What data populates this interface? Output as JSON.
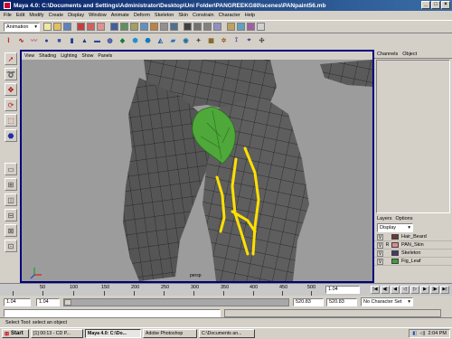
{
  "window": {
    "title": "Maya 4.0: C:\\Documents and Settings\\Administrator\\Desktop\\Uni Folder\\PANGREEKG80\\scenes\\PANpaint56.mb"
  },
  "menu": [
    "File",
    "Edit",
    "Modify",
    "Create",
    "Display",
    "Window",
    "Animate",
    "Deform",
    "Skeleton",
    "Skin",
    "Constrain",
    "Character",
    "Help"
  ],
  "statusline": {
    "mode": "Animation"
  },
  "panel_menu": [
    "View",
    "Shading",
    "Lighting",
    "Show",
    "Panels"
  ],
  "viewport": {
    "camera_label": "persp"
  },
  "channel_box": {
    "tabs": [
      "Channels",
      "Object"
    ]
  },
  "layers": {
    "tabs": [
      "Layers",
      "Options"
    ],
    "dropdown": "Display",
    "rows": [
      {
        "v": "V",
        "r": "",
        "name": "Hair_Beard",
        "color": "#6a3a32"
      },
      {
        "v": "V",
        "r": "R",
        "name": "PAN_Skin",
        "color": "#e08a8a"
      },
      {
        "v": "V",
        "r": "",
        "name": "Skeleton",
        "color": "#4a3a6a"
      },
      {
        "v": "V",
        "r": "",
        "name": "Fig_Leaf",
        "color": "#3aa03a"
      }
    ]
  },
  "timeline": {
    "ticks": [
      "50",
      "100",
      "150",
      "200",
      "250",
      "300",
      "350",
      "400",
      "450",
      "500"
    ],
    "current": "1.04"
  },
  "range": {
    "start": "1.04",
    "start_inner": "1.04",
    "end_inner": "520.83",
    "end": "520.83",
    "character_set": "No Character Set"
  },
  "help_line": "Select Tool: select an object",
  "taskbar": {
    "start": "Start",
    "tasks": [
      "[1] 00:13 - CD P...",
      "Maya 4.0: C:\\Do...",
      "Adobe Photoshop",
      "C:\\Documents an..."
    ],
    "clock": "2:04 PM"
  },
  "colors": {
    "viewport_bg": "#9c9c9c",
    "selection_frame": "#00007f",
    "stroke_yellow": "#ffe000",
    "leaf_green": "#4fa83a"
  }
}
